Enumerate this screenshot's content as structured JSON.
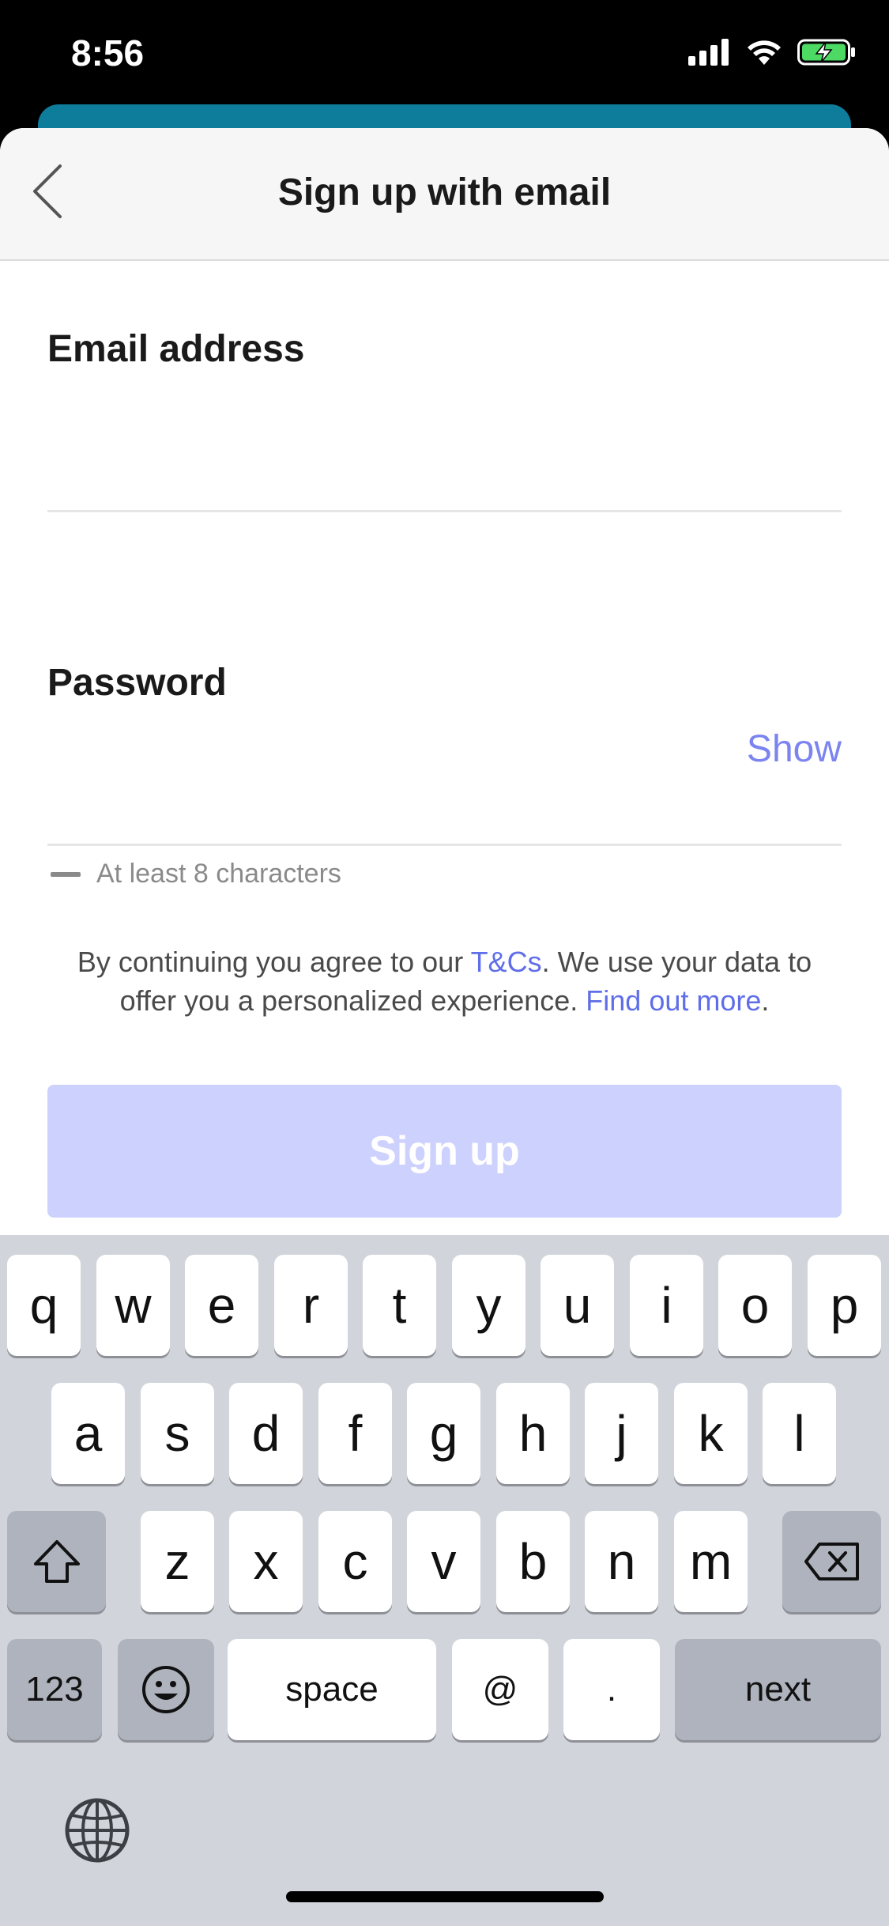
{
  "status_bar": {
    "time": "8:56"
  },
  "nav": {
    "title": "Sign up with email"
  },
  "form": {
    "email_label": "Email address",
    "email_value": "",
    "password_label": "Password",
    "password_value": "",
    "show_label": "Show",
    "hint": "At least 8 characters"
  },
  "terms": {
    "part1": "By continuing you agree to our ",
    "tcs_link": "T&Cs",
    "part2": ".  We use your data to offer you a personalized experience. ",
    "find_out_link": "Find out more",
    "part3": "."
  },
  "signup_button": "Sign up",
  "keyboard": {
    "row1": [
      "q",
      "w",
      "e",
      "r",
      "t",
      "y",
      "u",
      "i",
      "o",
      "p"
    ],
    "row2": [
      "a",
      "s",
      "d",
      "f",
      "g",
      "h",
      "j",
      "k",
      "l"
    ],
    "row3": [
      "z",
      "x",
      "c",
      "v",
      "b",
      "n",
      "m"
    ],
    "numbers_key": "123",
    "space_key": "space",
    "at_key": "@",
    "dot_key": ".",
    "next_key": "next"
  },
  "colors": {
    "accent": "#5f6ee8",
    "button_disabled": "#cdd1fd",
    "teal": "#0e7c9b"
  }
}
